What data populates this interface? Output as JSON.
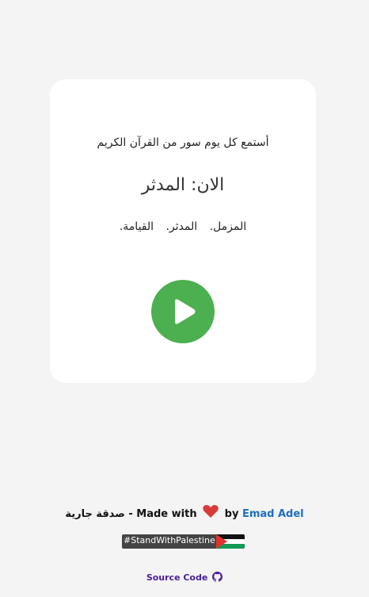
{
  "card": {
    "subtitle": "أستمع كل يوم سور من القرآن الكريم",
    "now_playing": "الان: المدثر",
    "surah_list": [
      "المزمل.",
      "المدثر.",
      "القيامة."
    ]
  },
  "play_button": {
    "icon": "play-icon",
    "color": "#4caf50"
  },
  "footer": {
    "charity_text": "صدقة جارية - Made with",
    "by_text": "by",
    "author": "Emad Adel",
    "author_color": "#1e6fc1",
    "heart_icon": "heart-icon",
    "badge_text": "#StandWithPalestine",
    "badge_flag_icon": "palestine-flag-icon",
    "source_label": "Source Code",
    "source_icon": "github-icon",
    "source_color": "#4a1d9c"
  }
}
